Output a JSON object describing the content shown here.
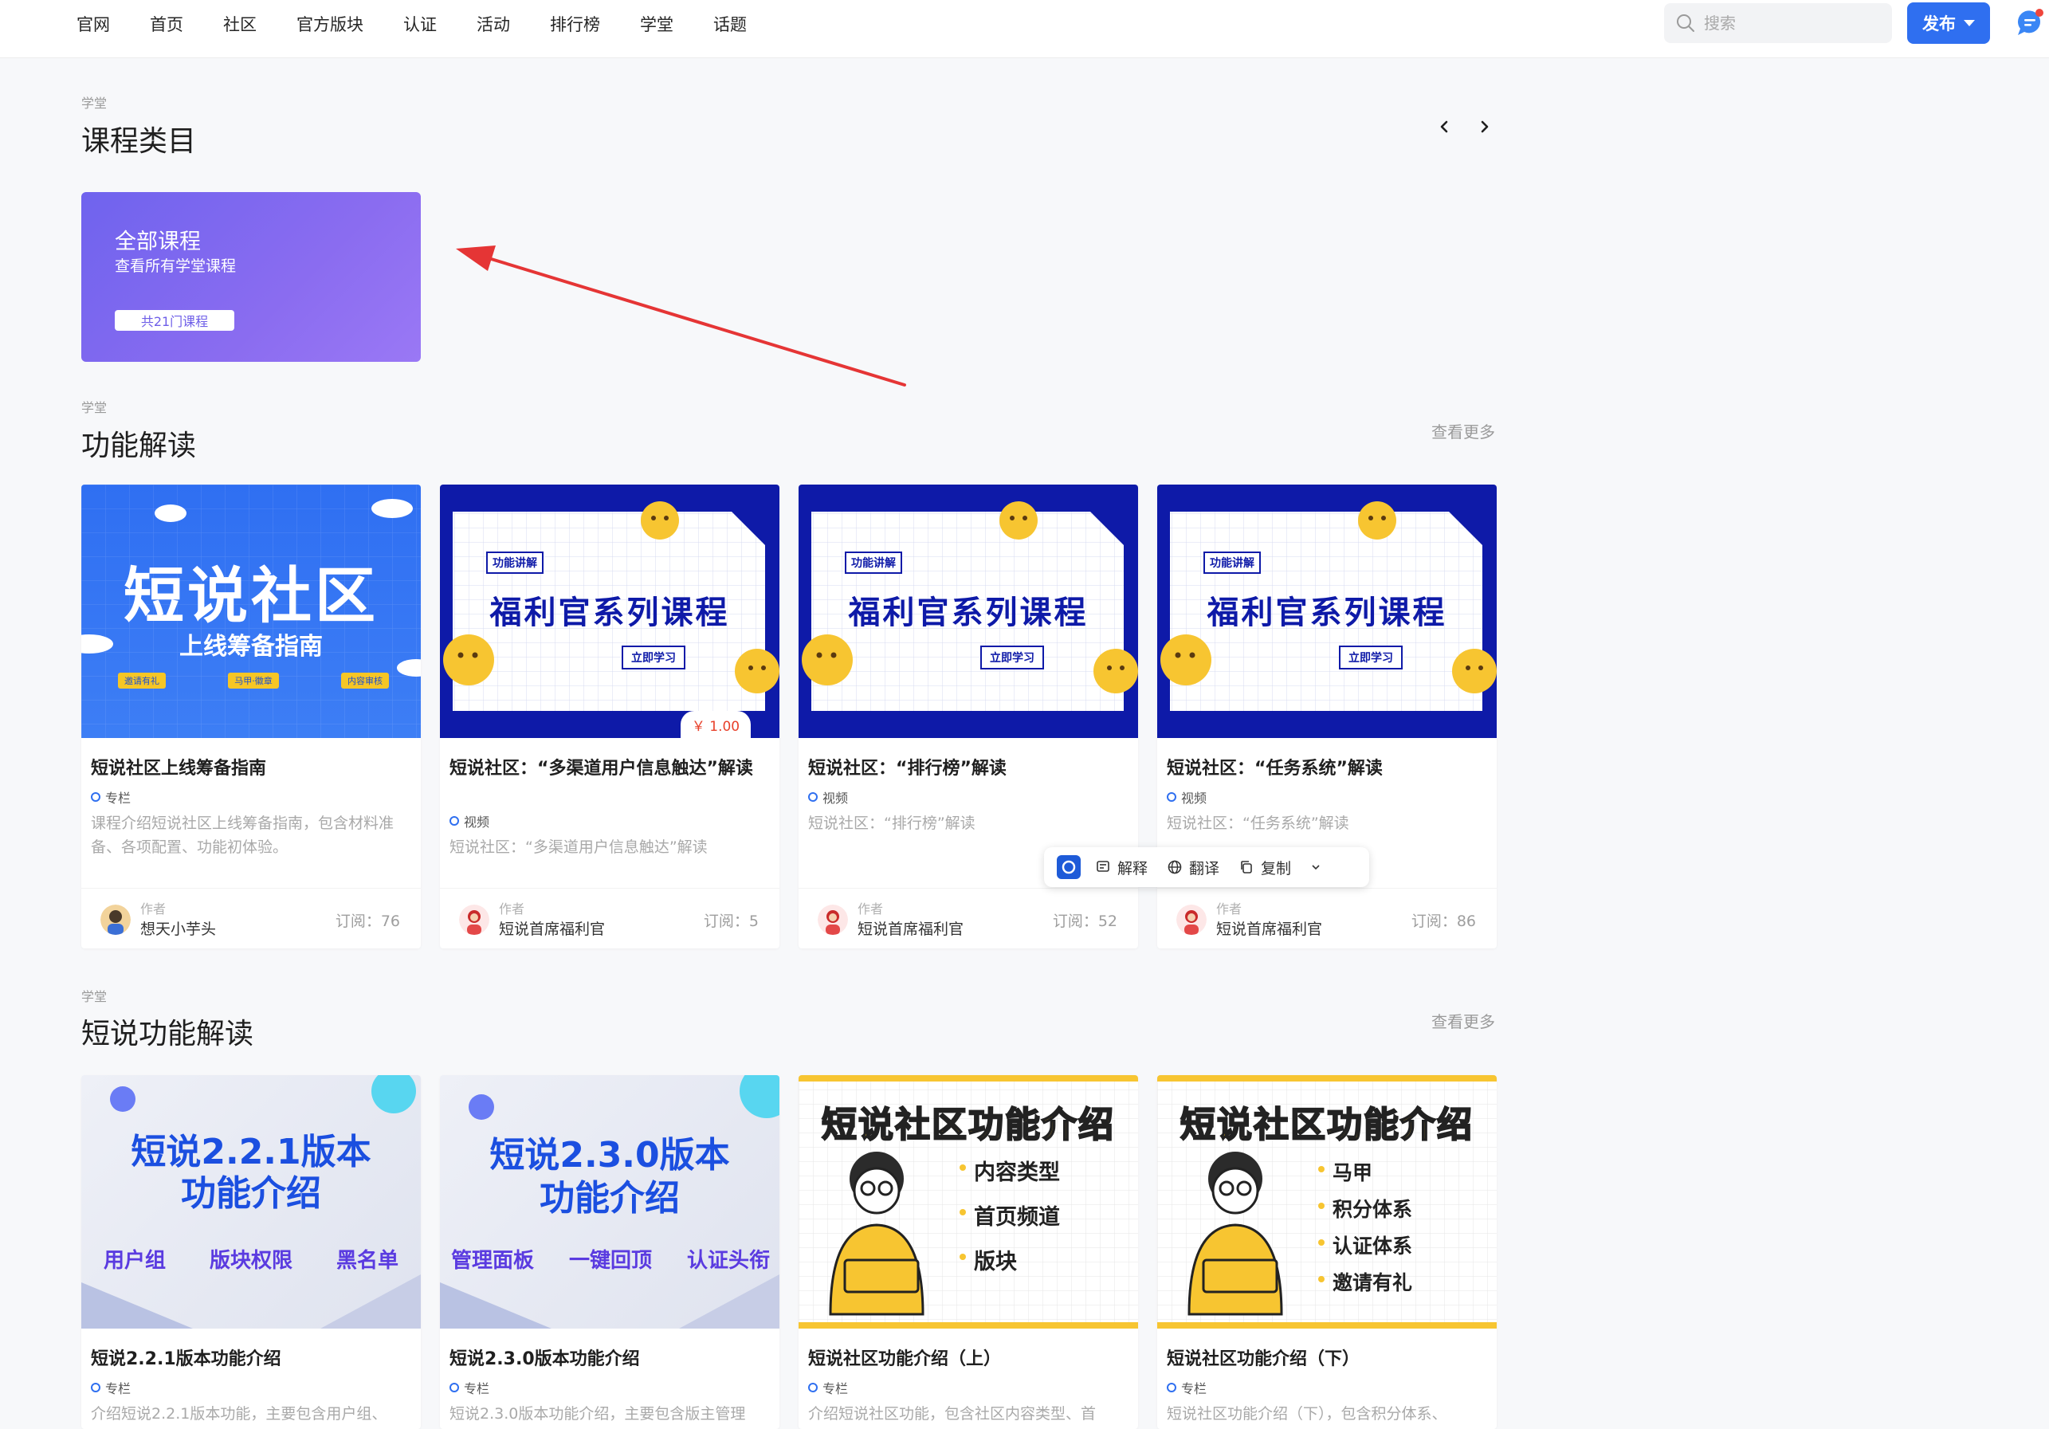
{
  "nav": {
    "items": [
      "官网",
      "首页",
      "社区",
      "官方版块",
      "认证",
      "活动",
      "排行榜",
      "学堂",
      "话题"
    ],
    "search_placeholder": "搜索",
    "publish_label": "发布"
  },
  "categories": {
    "kicker": "学堂",
    "title": "课程类目",
    "all_card": {
      "title": "全部课程",
      "subtitle": "查看所有学堂课程",
      "count": "共21门课程"
    }
  },
  "section1": {
    "kicker": "学堂",
    "title": "功能解读",
    "see_more": "查看更多",
    "cards": [
      {
        "cover": {
          "headline": "短说社区",
          "sub": "上线筹备指南",
          "tags": [
            "邀请有礼",
            "马甲·徽章",
            "内容审核"
          ]
        },
        "title": "短说社区上线筹备指南",
        "type": "专栏",
        "desc": "课程介绍短说社区上线筹备指南，包含材料准备、各项配置、功能初体验。",
        "author_label": "作者",
        "author": "想天小芋头",
        "subs": "订阅：76"
      },
      {
        "cover": {
          "tag": "功能讲解",
          "headline": "福利官系列课程",
          "button": "立即学习"
        },
        "price": "￥ 1.00",
        "title": "短说社区：“多渠道用户信息触达”解读",
        "type": "视频",
        "desc": "短说社区：“多渠道用户信息触达”解读",
        "author_label": "作者",
        "author": "短说首席福利官",
        "subs": "订阅：5"
      },
      {
        "cover": {
          "tag": "功能讲解",
          "headline": "福利官系列课程",
          "button": "立即学习"
        },
        "title": "短说社区：“排行榜”解读",
        "type": "视频",
        "desc": "短说社区：“排行榜”解读",
        "author_label": "作者",
        "author": "短说首席福利官",
        "subs": "订阅：52"
      },
      {
        "cover": {
          "tag": "功能讲解",
          "headline": "福利官系列课程",
          "button": "立即学习"
        },
        "title": "短说社区：“任务系统”解读",
        "type": "视频",
        "desc": "短说社区：“任务系统”解读",
        "author_label": "作者",
        "author": "短说首席福利官",
        "subs": "订阅：86"
      }
    ]
  },
  "float_toolbar": {
    "explain": "解释",
    "translate": "翻译",
    "copy": "复制"
  },
  "section2": {
    "kicker": "学堂",
    "title": "短说功能解读",
    "see_more": "查看更多",
    "cards": [
      {
        "cover": {
          "line1": "短说2.2.1版本",
          "line2": "功能介绍",
          "features": [
            "用户组",
            "版块权限",
            "黑名单"
          ]
        },
        "title": "短说2.2.1版本功能介绍",
        "type": "专栏",
        "desc": "介绍短说2.2.1版本功能，主要包含用户组、"
      },
      {
        "cover": {
          "line1": "短说2.3.0版本",
          "line2": "功能介绍",
          "features": [
            "管理面板",
            "一键回顶",
            "认证头衔"
          ]
        },
        "title": "短说2.3.0版本功能介绍",
        "type": "专栏",
        "desc": "短说2.3.0版本功能介绍，主要包含版主管理"
      },
      {
        "cover": {
          "banner": "短说社区功能介绍",
          "bullets": [
            "内容类型",
            "首页频道",
            "版块"
          ]
        },
        "title": "短说社区功能介绍（上）",
        "type": "专栏",
        "desc": "介绍短说社区功能，包含社区内容类型、首"
      },
      {
        "cover": {
          "banner": "短说社区功能介绍",
          "bullets": [
            "马甲",
            "积分体系",
            "认证体系",
            "邀请有礼"
          ]
        },
        "title": "短说社区功能介绍（下）",
        "type": "专栏",
        "desc": "短说社区功能介绍（下），包含积分体系、"
      }
    ]
  }
}
